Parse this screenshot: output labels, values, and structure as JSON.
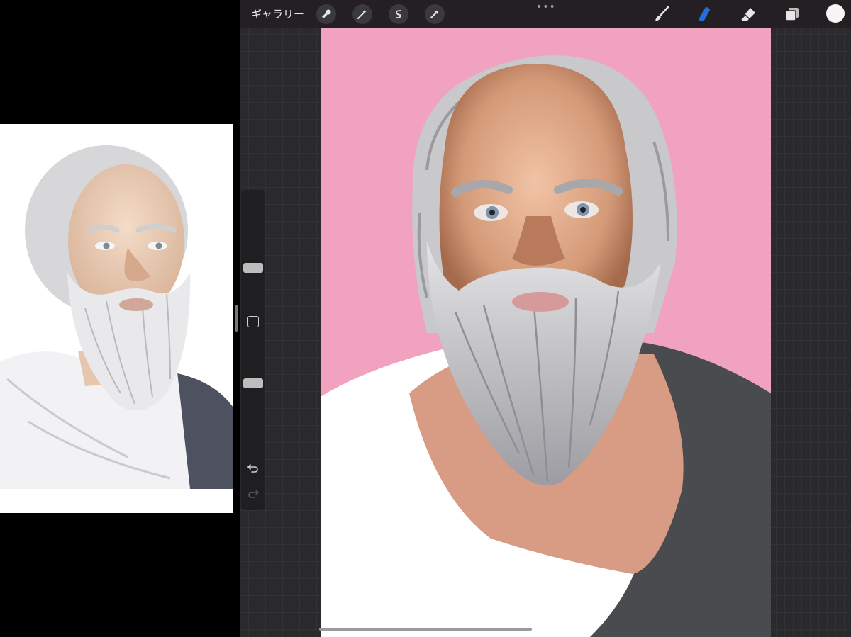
{
  "toolbar": {
    "gallery_label": "ギャラリー",
    "more_label": "•••",
    "tools": [
      "wrench-icon",
      "magic-wand-icon",
      "selection-icon",
      "transform-arrow-icon"
    ],
    "right_tools": [
      "brush-icon",
      "smudge-icon",
      "eraser-icon",
      "layers-icon"
    ],
    "active_tool": "smudge-icon",
    "active_color": "#1f6fe0",
    "current_color": "#f5f5f5"
  },
  "sidebar": {
    "brush_size_level": 0.35,
    "opacity_level": 0.6
  },
  "canvas": {
    "background_color": "#f0a2bf"
  }
}
